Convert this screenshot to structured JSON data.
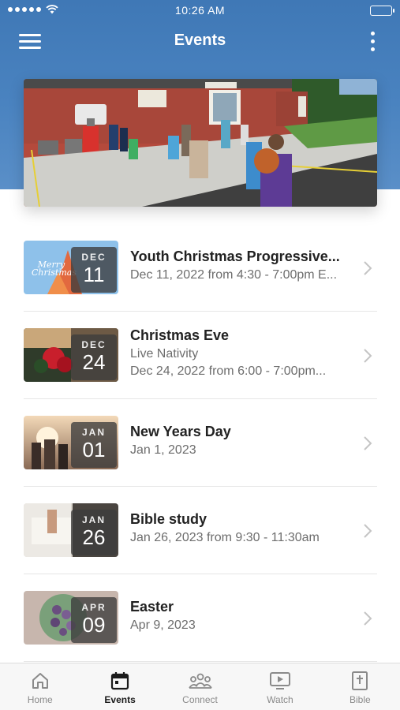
{
  "status_bar": {
    "time": "10:26 AM"
  },
  "nav": {
    "title": "Events"
  },
  "events": [
    {
      "month": "DEC",
      "day": "11",
      "title": "Youth Christmas Progressive...",
      "lines": [
        "Dec 11, 2022 from 4:30 - 7:00pm E..."
      ],
      "thumb_text": "Merry Christmas"
    },
    {
      "month": "DEC",
      "day": "24",
      "title": "Christmas Eve",
      "lines": [
        "Live Nativity",
        "Dec 24, 2022 from 6:00 - 7:00pm..."
      ]
    },
    {
      "month": "JAN",
      "day": "01",
      "title": "New Years Day",
      "lines": [
        "Jan 1, 2023"
      ]
    },
    {
      "month": "JAN",
      "day": "26",
      "title": "Bible study",
      "lines": [
        "Jan 26, 2023 from 9:30 - 11:30am"
      ]
    },
    {
      "month": "APR",
      "day": "09",
      "title": "Easter",
      "lines": [
        "Apr 9, 2023"
      ]
    }
  ],
  "tabs": [
    {
      "label": "Home",
      "icon": "home-icon",
      "active": false
    },
    {
      "label": "Events",
      "icon": "calendar-icon",
      "active": true
    },
    {
      "label": "Connect",
      "icon": "people-icon",
      "active": false
    },
    {
      "label": "Watch",
      "icon": "tv-play-icon",
      "active": false
    },
    {
      "label": "Bible",
      "icon": "bible-icon",
      "active": false
    }
  ],
  "colors": {
    "header_blue": "#4a83c0",
    "tab_active": "#1a1a1a",
    "tab_inactive": "#8a8a8a"
  }
}
